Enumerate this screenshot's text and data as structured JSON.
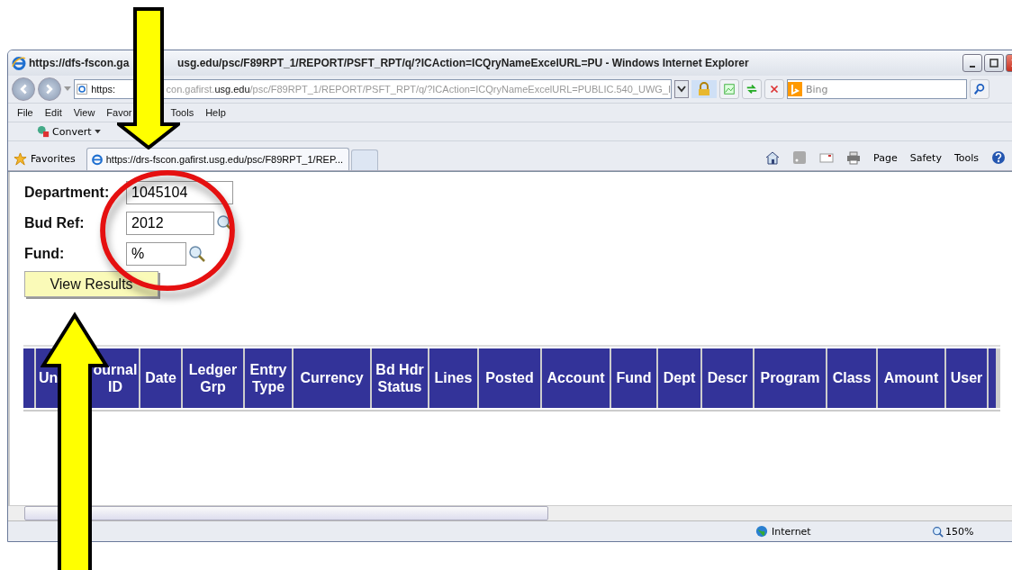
{
  "window": {
    "title_parts": [
      "https://dfs-fscon.ga",
      "usg.edu/psc/F89RPT_1/REPORT/PSFT_RPT/q/?ICAction=ICQryNameExcelURL=PU - Windows Internet Explorer"
    ]
  },
  "address_bar": {
    "url_parts": [
      "https:",
      "con.gafirst.",
      "usg.edu",
      "/psc/F89RPT_1/REPORT/PSFT_RPT/q/?ICAction=ICQryNameExcelURL=PUBLIC.540_UWG_I"
    ]
  },
  "search": {
    "placeholder": "Bing"
  },
  "menu": [
    "File",
    "Edit",
    "View",
    "Favor",
    "Tools",
    "Help"
  ],
  "command_bar": {
    "convert": "Convert",
    "right_items": [
      "Page",
      "Safety",
      "Tools"
    ]
  },
  "favorites": {
    "label": "Favorites"
  },
  "tabs": [
    {
      "label": "https://drs-fscon.gafirst.usg.edu/psc/F89RPT_1/REP...",
      "selected": true
    }
  ],
  "form": {
    "fields": [
      {
        "label": "Department:",
        "value": "1045104",
        "lookup": false
      },
      {
        "label": "Bud Ref:",
        "value": "2012",
        "lookup": true
      },
      {
        "label": "Fund:",
        "value": "%",
        "lookup": true
      }
    ],
    "button": "View Results"
  },
  "table": {
    "columns": [
      "Un",
      "ournal ID",
      "Date",
      "Ledger Grp",
      "Entry Type",
      "Currency",
      "Bd Hdr Status",
      "Lines",
      "Posted",
      "Account",
      "Fund",
      "Dept",
      "Descr",
      "Program",
      "Class",
      "Amount",
      "User"
    ]
  },
  "status_bar": {
    "zone": "Internet",
    "zoom": "150%"
  }
}
